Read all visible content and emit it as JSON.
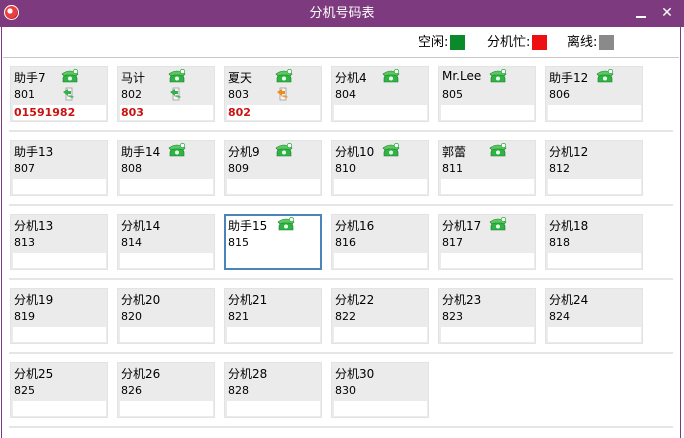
{
  "window": {
    "title": "分机号码表"
  },
  "legend": {
    "idle": {
      "label": "空闲:",
      "color": "#0b8a2b"
    },
    "busy": {
      "label": "分机忙:",
      "color": "#ee1010"
    },
    "offline": {
      "label": "离线:",
      "color": "#8a8a8a"
    }
  },
  "extensions": [
    {
      "name": "助手7",
      "ext": "801",
      "value": "01591982",
      "phone": true,
      "transfer": "green"
    },
    {
      "name": "马计",
      "ext": "802",
      "value": "803",
      "phone": true,
      "transfer": "green"
    },
    {
      "name": "夏天",
      "ext": "803",
      "value": "802",
      "phone": true,
      "transfer": "orange"
    },
    {
      "name": "分机4",
      "ext": "804",
      "value": "",
      "phone": true,
      "transfer": null
    },
    {
      "name": "Mr.Lee",
      "ext": "805",
      "value": "",
      "phone": true,
      "transfer": null
    },
    {
      "name": "助手12",
      "ext": "806",
      "value": "",
      "phone": true,
      "transfer": null
    },
    {
      "name": "助手13",
      "ext": "807",
      "value": "",
      "phone": false,
      "transfer": null
    },
    {
      "name": "助手14",
      "ext": "808",
      "value": "",
      "phone": true,
      "transfer": null
    },
    {
      "name": "分机9",
      "ext": "809",
      "value": "",
      "phone": true,
      "transfer": null
    },
    {
      "name": "分机10",
      "ext": "810",
      "value": "",
      "phone": true,
      "transfer": null
    },
    {
      "name": "郭蕾",
      "ext": "811",
      "value": "",
      "phone": true,
      "transfer": null
    },
    {
      "name": "分机12",
      "ext": "812",
      "value": "",
      "phone": false,
      "transfer": null
    },
    {
      "name": "分机13",
      "ext": "813",
      "value": "",
      "phone": false,
      "transfer": null
    },
    {
      "name": "分机14",
      "ext": "814",
      "value": "",
      "phone": false,
      "transfer": null
    },
    {
      "name": "助手15",
      "ext": "815",
      "value": "",
      "phone": true,
      "transfer": null,
      "selected": true
    },
    {
      "name": "分机16",
      "ext": "816",
      "value": "",
      "phone": false,
      "transfer": null
    },
    {
      "name": "分机17",
      "ext": "817",
      "value": "",
      "phone": true,
      "transfer": null
    },
    {
      "name": "分机18",
      "ext": "818",
      "value": "",
      "phone": false,
      "transfer": null
    },
    {
      "name": "分机19",
      "ext": "819",
      "value": "",
      "phone": false,
      "transfer": null
    },
    {
      "name": "分机20",
      "ext": "820",
      "value": "",
      "phone": false,
      "transfer": null
    },
    {
      "name": "分机21",
      "ext": "821",
      "value": "",
      "phone": false,
      "transfer": null
    },
    {
      "name": "分机22",
      "ext": "822",
      "value": "",
      "phone": false,
      "transfer": null
    },
    {
      "name": "分机23",
      "ext": "823",
      "value": "",
      "phone": false,
      "transfer": null
    },
    {
      "name": "分机24",
      "ext": "824",
      "value": "",
      "phone": false,
      "transfer": null
    },
    {
      "name": "分机25",
      "ext": "825",
      "value": "",
      "phone": false,
      "transfer": null
    },
    {
      "name": "分机26",
      "ext": "826",
      "value": "",
      "phone": false,
      "transfer": null
    },
    {
      "name": "分机28",
      "ext": "828",
      "value": "",
      "phone": false,
      "transfer": null
    },
    {
      "name": "分机30",
      "ext": "830",
      "value": "",
      "phone": false,
      "transfer": null
    }
  ]
}
